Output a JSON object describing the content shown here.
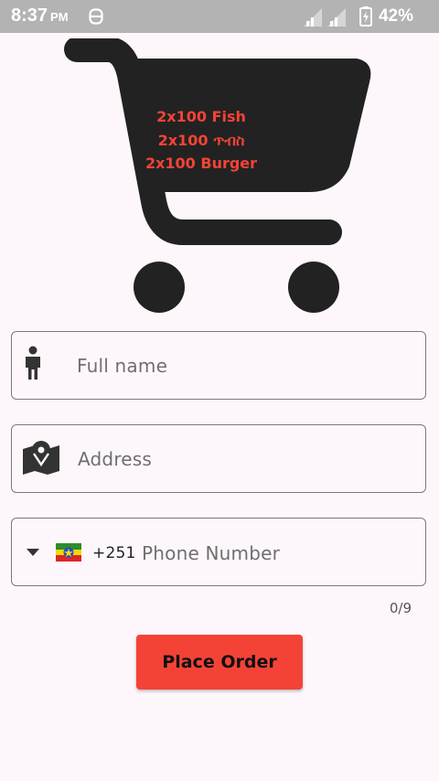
{
  "status_bar": {
    "time": "8:37",
    "ampm": "PM",
    "battery_percent": "42%",
    "icons": [
      "hdr-icon",
      "signal-icon",
      "signal-icon",
      "battery-charging-icon"
    ]
  },
  "cart": {
    "icon": "shopping-cart-icon",
    "items": [
      "2x100 Fish",
      "2x100 ጥብስ",
      "2x100 Burger"
    ]
  },
  "form": {
    "full_name": {
      "placeholder": "Full name",
      "icon": "person-icon"
    },
    "address": {
      "placeholder": "Address",
      "icon": "map-icon"
    },
    "phone": {
      "country_flag": "🇪🇹",
      "country_code": "+251",
      "placeholder": "Phone Number",
      "counter": "0/9"
    },
    "submit_label": "Place Order"
  },
  "colors": {
    "accent": "#f44336",
    "cart": "#222222",
    "status_bar": "#b3b3b3"
  }
}
